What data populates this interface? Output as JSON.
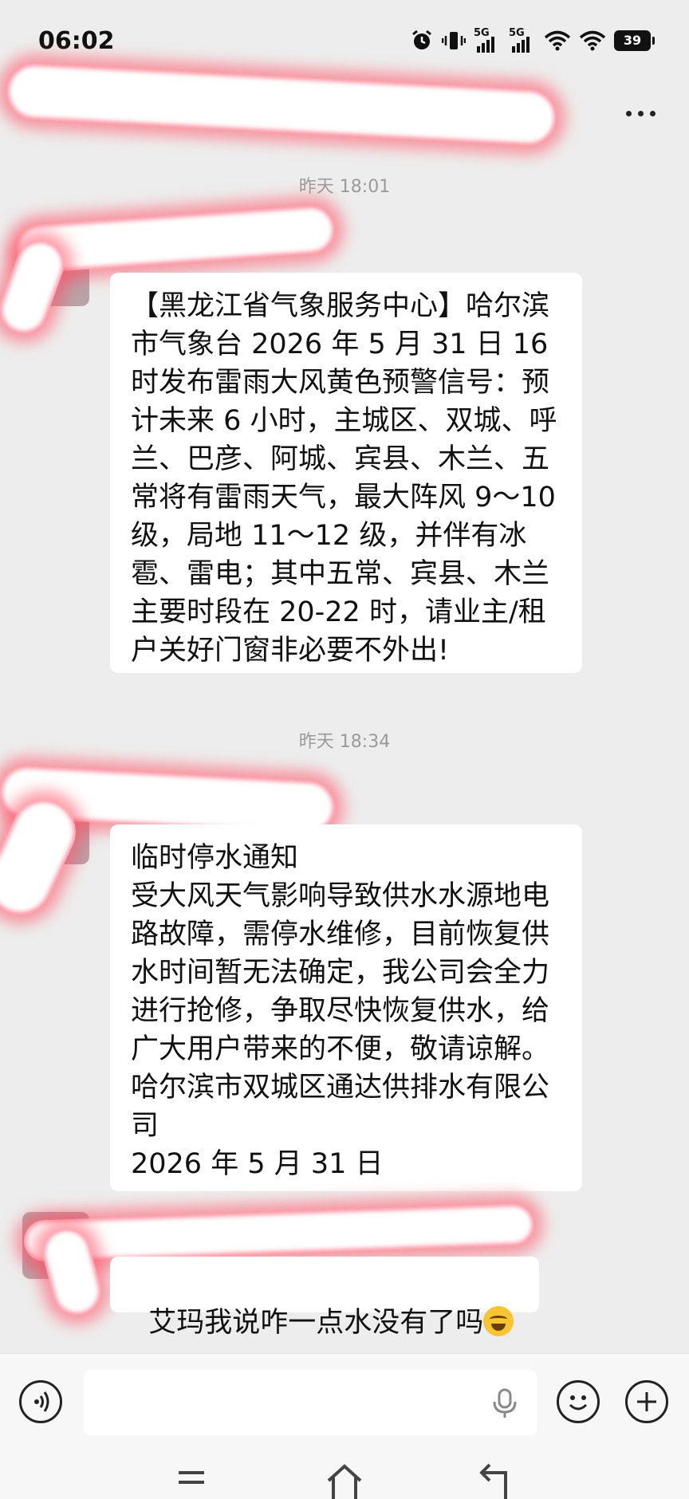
{
  "status_bar": {
    "time": "06:02",
    "network_1": "5G",
    "network_2": "5G",
    "battery": "39"
  },
  "header": {
    "title": ""
  },
  "messages": [
    {
      "timestamp": "昨天 18:01",
      "text": "【黑龙江省气象服务中心】哈尔滨市气象台 2026 年 5 月 31 日 16 时发布雷雨大风黄色预警信号：预计未来 6 小时，主城区、双城、呼兰、巴彦、阿城、宾县、木兰、五常将有雷雨天气，最大阵风 9～10 级，局地 11～12 级，并伴有冰雹、雷电；其中五常、宾县、木兰主要时段在 20-22 时，请业主/租户关好门窗非必要不外出!"
    },
    {
      "timestamp": "昨天 18:34",
      "text": "临时停水通知\n受大风天气影响导致供水水源地电路故障，需停水维修，目前恢复供水时间暂无法确定，我公司会全力进行抢修，争取尽快恢复供水，给广大用户带来的不便，敬请谅解。\n哈尔滨市双城区通达供排水有限公司\n2026 年 5 月 31 日"
    },
    {
      "text": "艾玛我说咋一点水没有了吗",
      "emoji": "crying-laughing-emoji"
    }
  ],
  "input": {
    "placeholder": ""
  },
  "icons": {
    "voice_toggle": "voice-icon",
    "mic": "mic-icon",
    "emoji": "emoji-icon",
    "add": "plus-icon",
    "more": "more-icon"
  }
}
